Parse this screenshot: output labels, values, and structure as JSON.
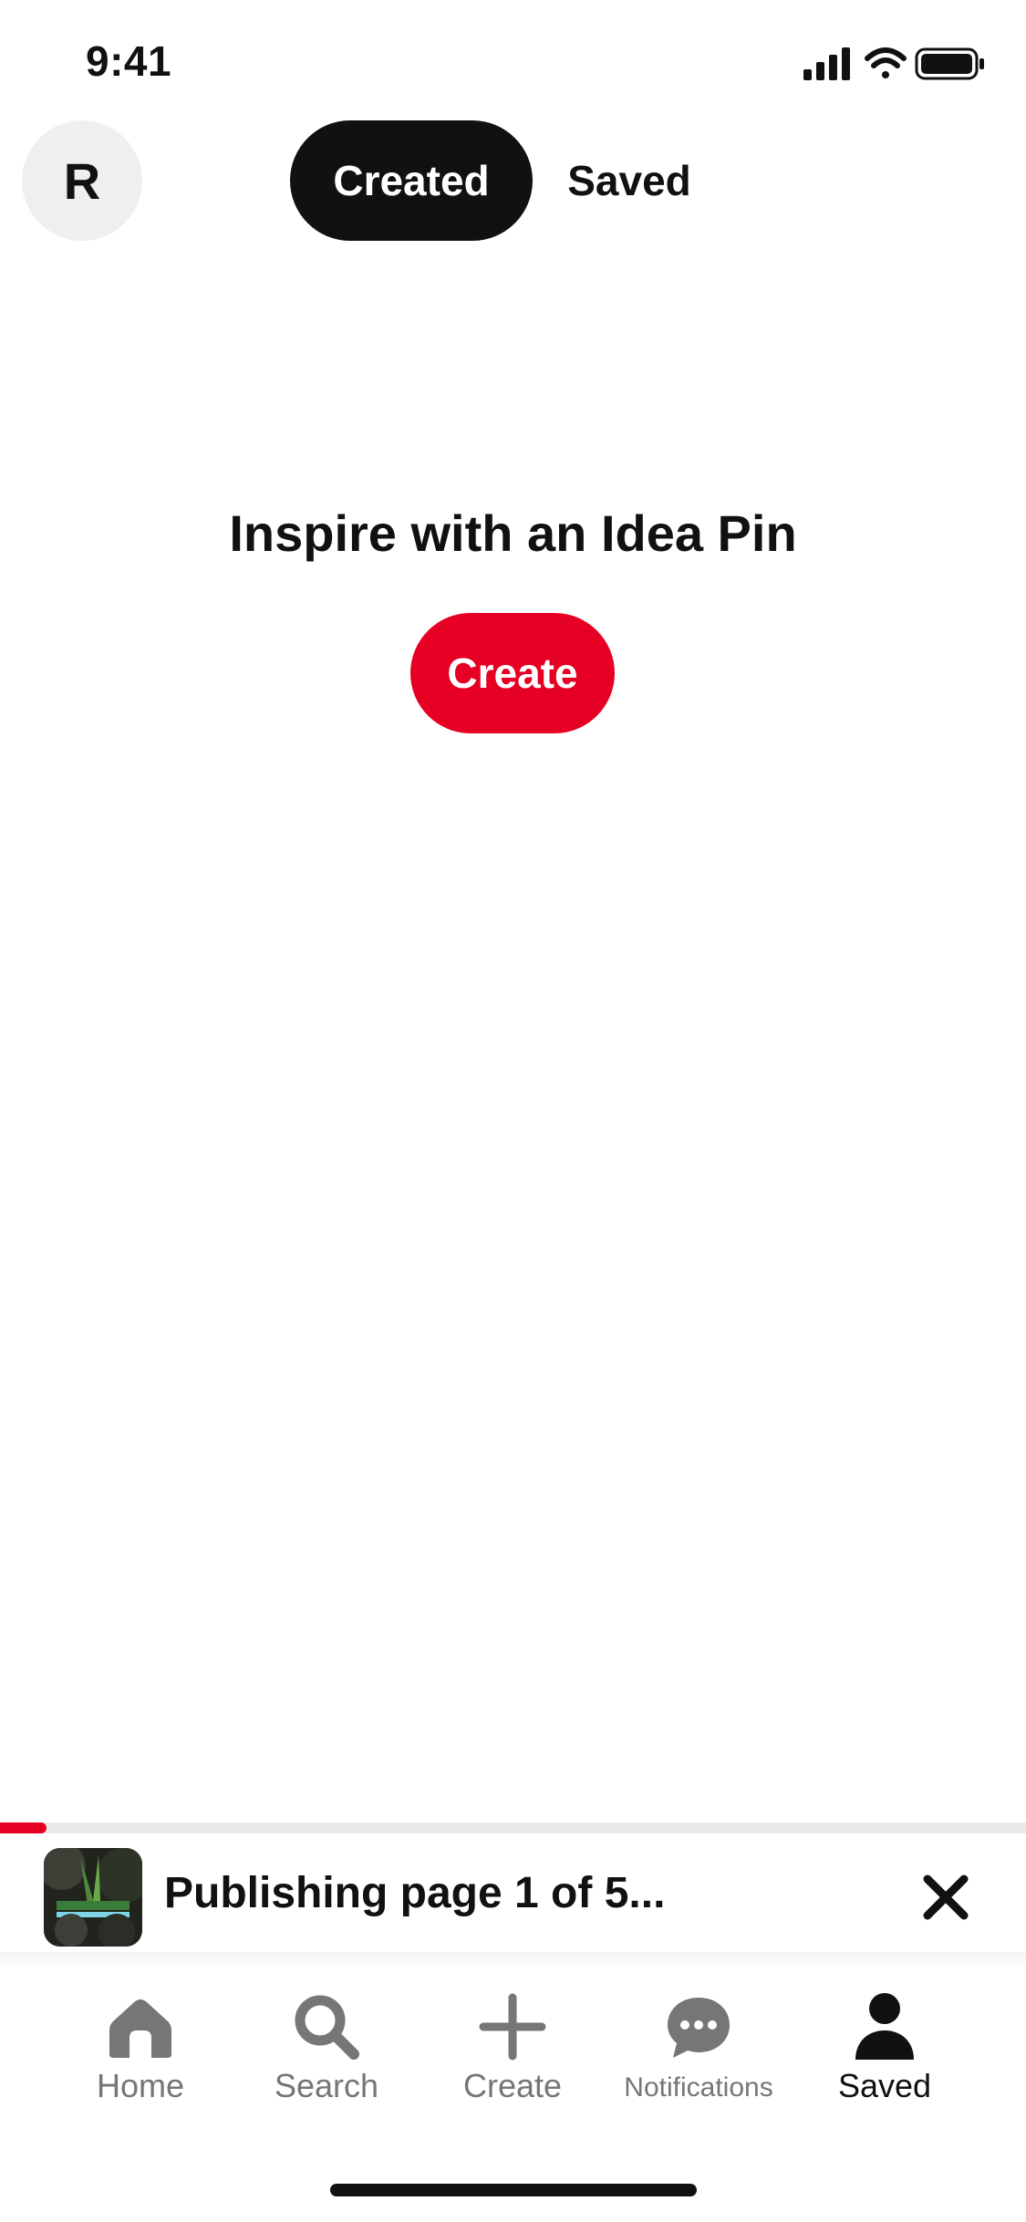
{
  "status_bar": {
    "time": "9:41"
  },
  "header": {
    "avatar_initial": "R",
    "tabs": [
      {
        "label": "Created",
        "selected": true
      },
      {
        "label": "Saved",
        "selected": false
      }
    ]
  },
  "empty_state": {
    "title": "Inspire with an Idea Pin",
    "button_label": "Create",
    "button_color": "#e60023"
  },
  "publishing": {
    "text": "Publishing page 1 of 5...",
    "progress": 0.045,
    "progress_color": "#e60023",
    "close_icon": "close-icon"
  },
  "bottom_nav": {
    "items": [
      {
        "label": "Home",
        "icon": "home-icon",
        "active": false
      },
      {
        "label": "Search",
        "icon": "search-icon",
        "active": false
      },
      {
        "label": "Create",
        "icon": "plus-icon",
        "active": false
      },
      {
        "label": "Notifications",
        "icon": "chat-bubble-icon",
        "active": false
      },
      {
        "label": "Saved",
        "icon": "person-icon",
        "active": true
      }
    ]
  }
}
